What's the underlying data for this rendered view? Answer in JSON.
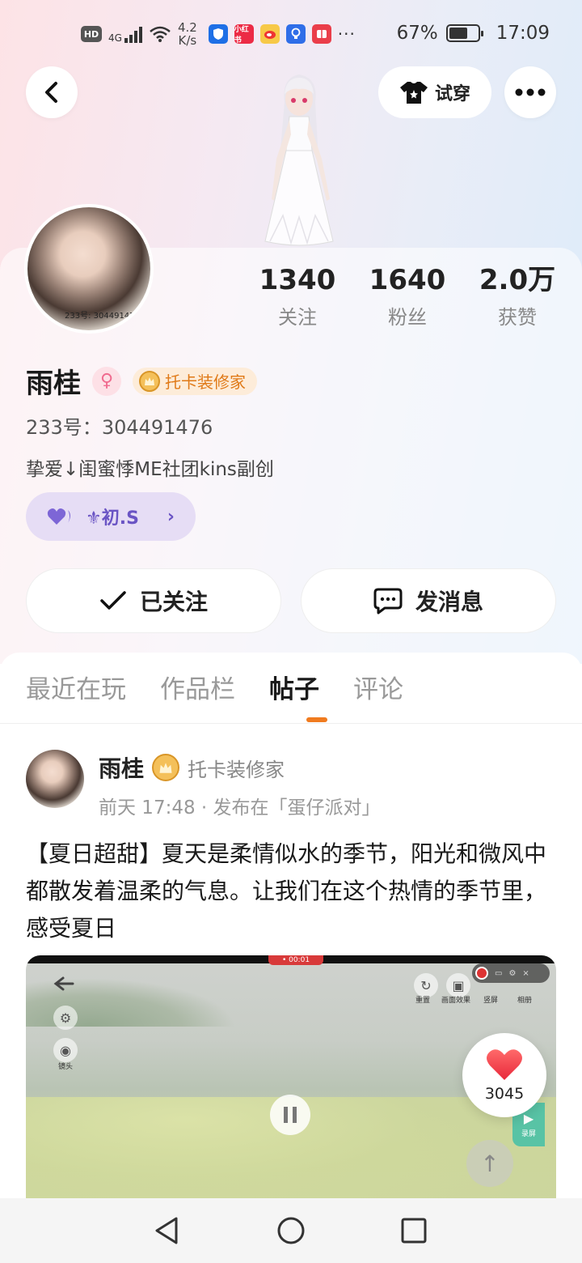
{
  "status_bar": {
    "hd": "HD",
    "network": "4G",
    "speed_top": "4.2",
    "speed_bottom": "K/s",
    "app_icons": [
      "shield-icon",
      "xiaohongshu-icon",
      "weibo-icon",
      "bulb-icon",
      "book-icon"
    ],
    "xhs_label": "小红书",
    "more": "···",
    "battery_percent": "67%",
    "battery_level": 0.67,
    "time": "17:09"
  },
  "header": {
    "back_icon": "chevron-left-icon",
    "try_on_label": "试穿",
    "more_icon": "more-dots-icon"
  },
  "profile": {
    "avatar_id_text": "233号: 304491476",
    "stats": [
      {
        "value": "1340",
        "label": "关注"
      },
      {
        "value": "1640",
        "label": "粉丝"
      },
      {
        "value": "2.0万",
        "label": "获赞"
      }
    ],
    "name": "雨桂",
    "gender_symbol": "♀",
    "badge_title": "托卡装修家",
    "account_label": "233号：",
    "account_id": "304491476",
    "bio": "挚爱↓闺蜜悸ME社团kins副创",
    "club_label": "⚜初.S",
    "club_chevron": "›",
    "follow_label": "已关注",
    "message_label": "发消息"
  },
  "tabs": [
    {
      "label": "最近在玩",
      "active": false
    },
    {
      "label": "作品栏",
      "active": false
    },
    {
      "label": "帖子",
      "active": true
    },
    {
      "label": "评论",
      "active": false
    }
  ],
  "post": {
    "author": "雨桂",
    "author_badge": "托卡装修家",
    "time": "前天 17:48",
    "separator": "·",
    "published_in": "发布在「蛋仔派对」",
    "text": "【夏日超甜】夏天是柔情似水的季节，阳光和微风中都散发着温柔的气息。让我们在这个热情的季节里，感受夏日",
    "media": {
      "record_time": "• 00:01",
      "tool_labels": [
        "重置",
        "画面效果",
        "竖屏",
        "相册"
      ],
      "camera_label": "镜头",
      "record_label": "录屏"
    },
    "likes": "3045"
  },
  "colors": {
    "accent": "#f07b1f",
    "club_purple": "#6a54c4",
    "badge_orange": "#e07a18",
    "like_red": "#f0434f"
  }
}
